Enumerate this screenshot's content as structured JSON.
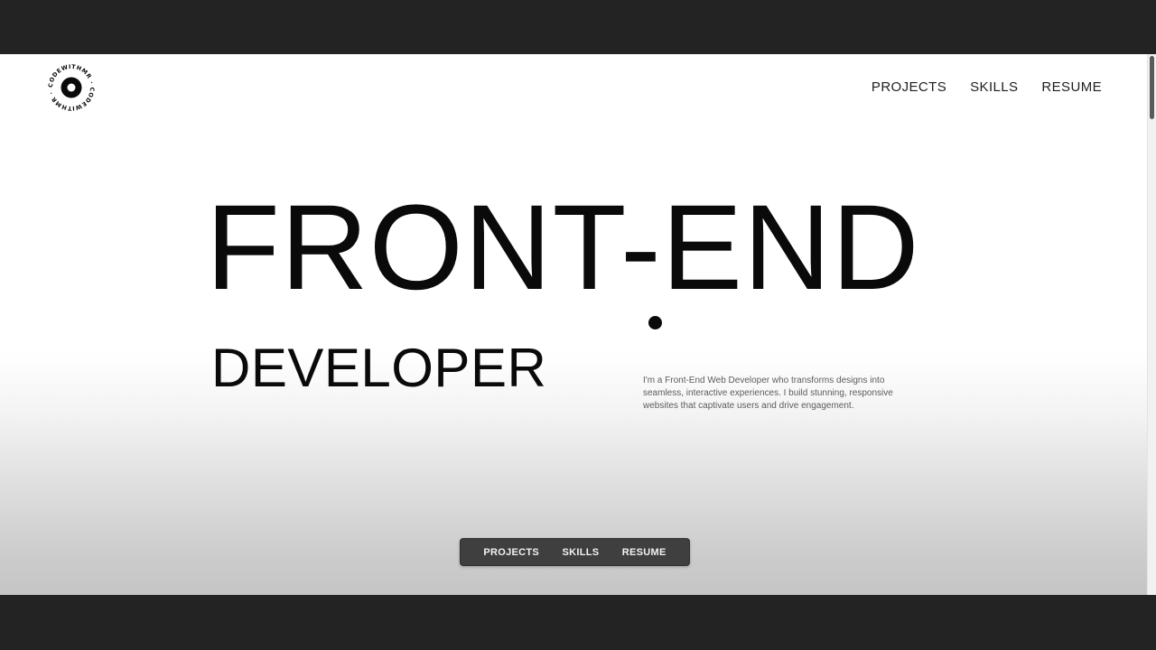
{
  "logo": {
    "ring_text": "CODEWITHMR · CODEWITHMR · "
  },
  "header": {
    "nav": [
      {
        "label": "PROJECTS"
      },
      {
        "label": "SKILLS"
      },
      {
        "label": "RESUME"
      }
    ]
  },
  "hero": {
    "title": "FRONT-END",
    "subtitle": "DEVELOPER",
    "description": "I'm a Front-End Web Developer who transforms designs into seamless, interactive experiences. I build stunning, responsive websites that captivate users and drive engagement."
  },
  "bottom_nav": {
    "items": [
      {
        "label": "PROJECTS"
      },
      {
        "label": "SKILLS"
      },
      {
        "label": "RESUME"
      }
    ]
  },
  "colors": {
    "text": "#0a0a0a",
    "pill_bg": "#3f3f3f",
    "pill_text": "#f2f2f2"
  }
}
